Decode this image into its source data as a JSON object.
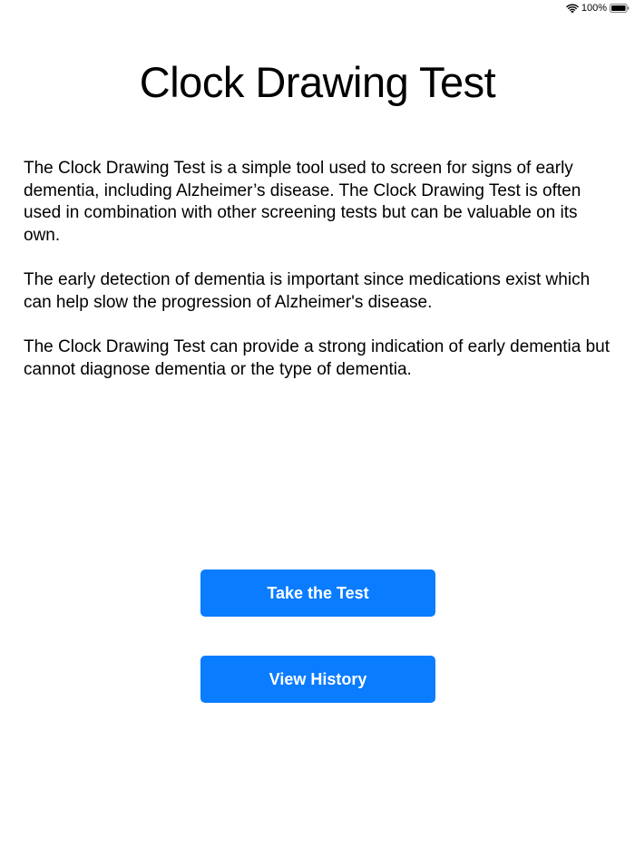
{
  "status_bar": {
    "battery_percent": "100%",
    "icons": [
      "wifi-icon",
      "battery-icon"
    ]
  },
  "title": "Clock Drawing Test",
  "paragraphs": [
    "The Clock Drawing Test is a simple tool used to screen for signs of early dementia, including Alzheimer’s disease. The Clock Drawing Test is often used in combination with other screening tests but can be valuable on its own.",
    "The early detection of dementia is important since medications exist which can help slow the progression of Alzheimer's disease.",
    "The Clock Drawing Test can provide a strong indication of early dementia but cannot diagnose dementia or the type of dementia."
  ],
  "buttons": {
    "take_test": "Take the Test",
    "view_history": "View History"
  },
  "colors": {
    "accent": "#0a7cff",
    "background": "#ffffff",
    "text": "#000000"
  }
}
